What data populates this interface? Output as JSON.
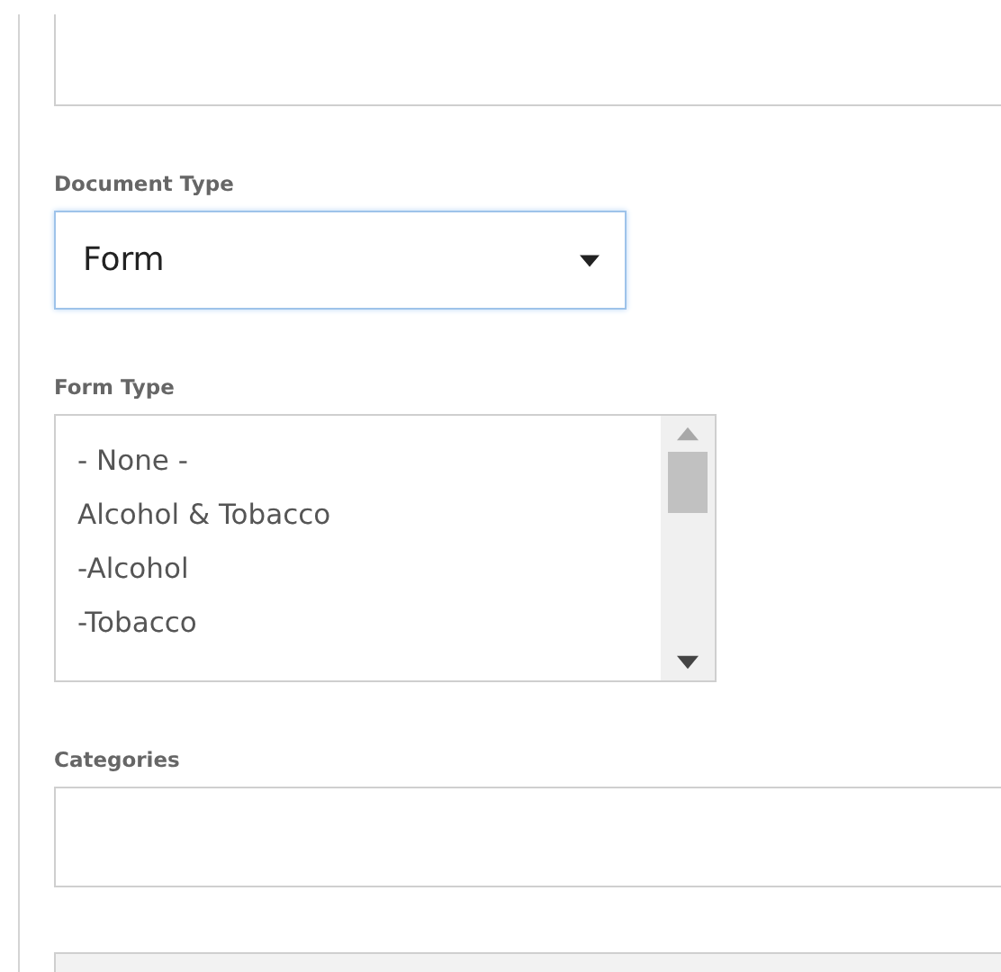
{
  "fields": [
    {
      "kind": "textarea"
    },
    {
      "kind": "select",
      "label": "Document Type",
      "value": "Form",
      "focused": true
    },
    {
      "kind": "listbox",
      "label": "Form Type",
      "options": [
        {
          "label": "- None -",
          "selected": false
        },
        {
          "label": "Alcohol & Tobacco",
          "selected": false
        },
        {
          "label": "-Alcohol",
          "selected": false
        },
        {
          "label": "-Tobacco",
          "selected": false
        }
      ]
    },
    {
      "kind": "text",
      "label": "Categories",
      "disabled": false
    },
    {
      "kind": "text",
      "disabled": true
    }
  ]
}
